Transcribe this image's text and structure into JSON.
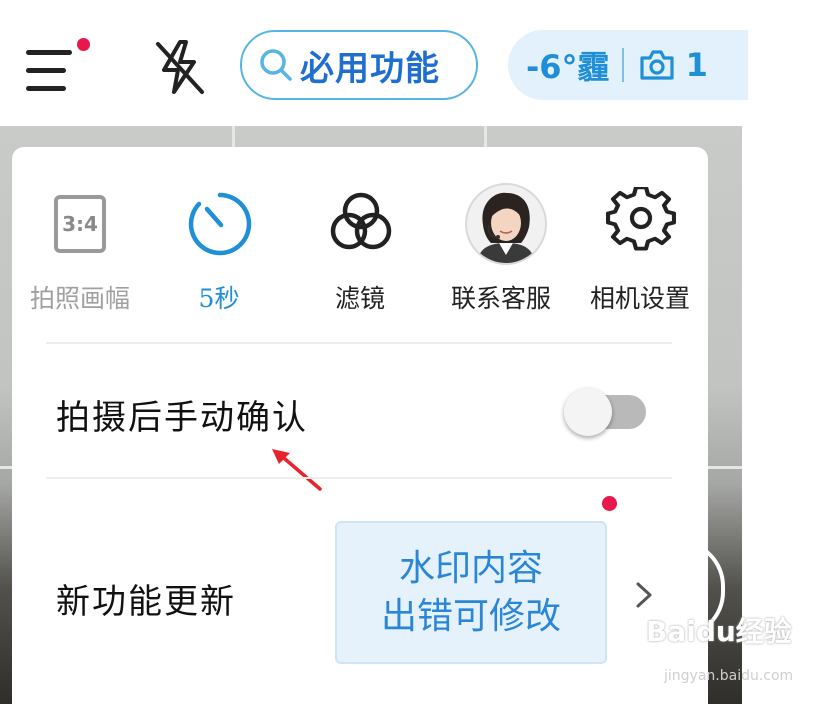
{
  "topbar": {
    "search_label": "必用功能",
    "weather_text": "-6°霾",
    "photo_count": "1"
  },
  "quick_actions": [
    {
      "label": "拍照画幅",
      "icon": "aspect-ratio-icon",
      "badge": "3:4",
      "color": "#a0a0a0"
    },
    {
      "label": "5秒",
      "icon": "timer-icon",
      "color": "#1f8fd8"
    },
    {
      "label": "滤镜",
      "icon": "filter-icon",
      "color": "#222222"
    },
    {
      "label": "联系客服",
      "icon": "customer-service-avatar",
      "color": "#222222"
    },
    {
      "label": "相机设置",
      "icon": "gear-icon",
      "color": "#222222"
    }
  ],
  "rows": {
    "manual_confirm_label": "拍摄后手动确认",
    "manual_confirm_on": false,
    "update_label": "新功能更新",
    "update_card_line1": "水印内容",
    "update_card_line2": "出错可修改"
  },
  "watermark": {
    "logo": "Baidu经验",
    "sub": "jingyan.baidu.com"
  },
  "colors": {
    "accent": "#1f8fd8",
    "badge_red": "#e8184a",
    "card_bg": "#e6f2fb"
  }
}
